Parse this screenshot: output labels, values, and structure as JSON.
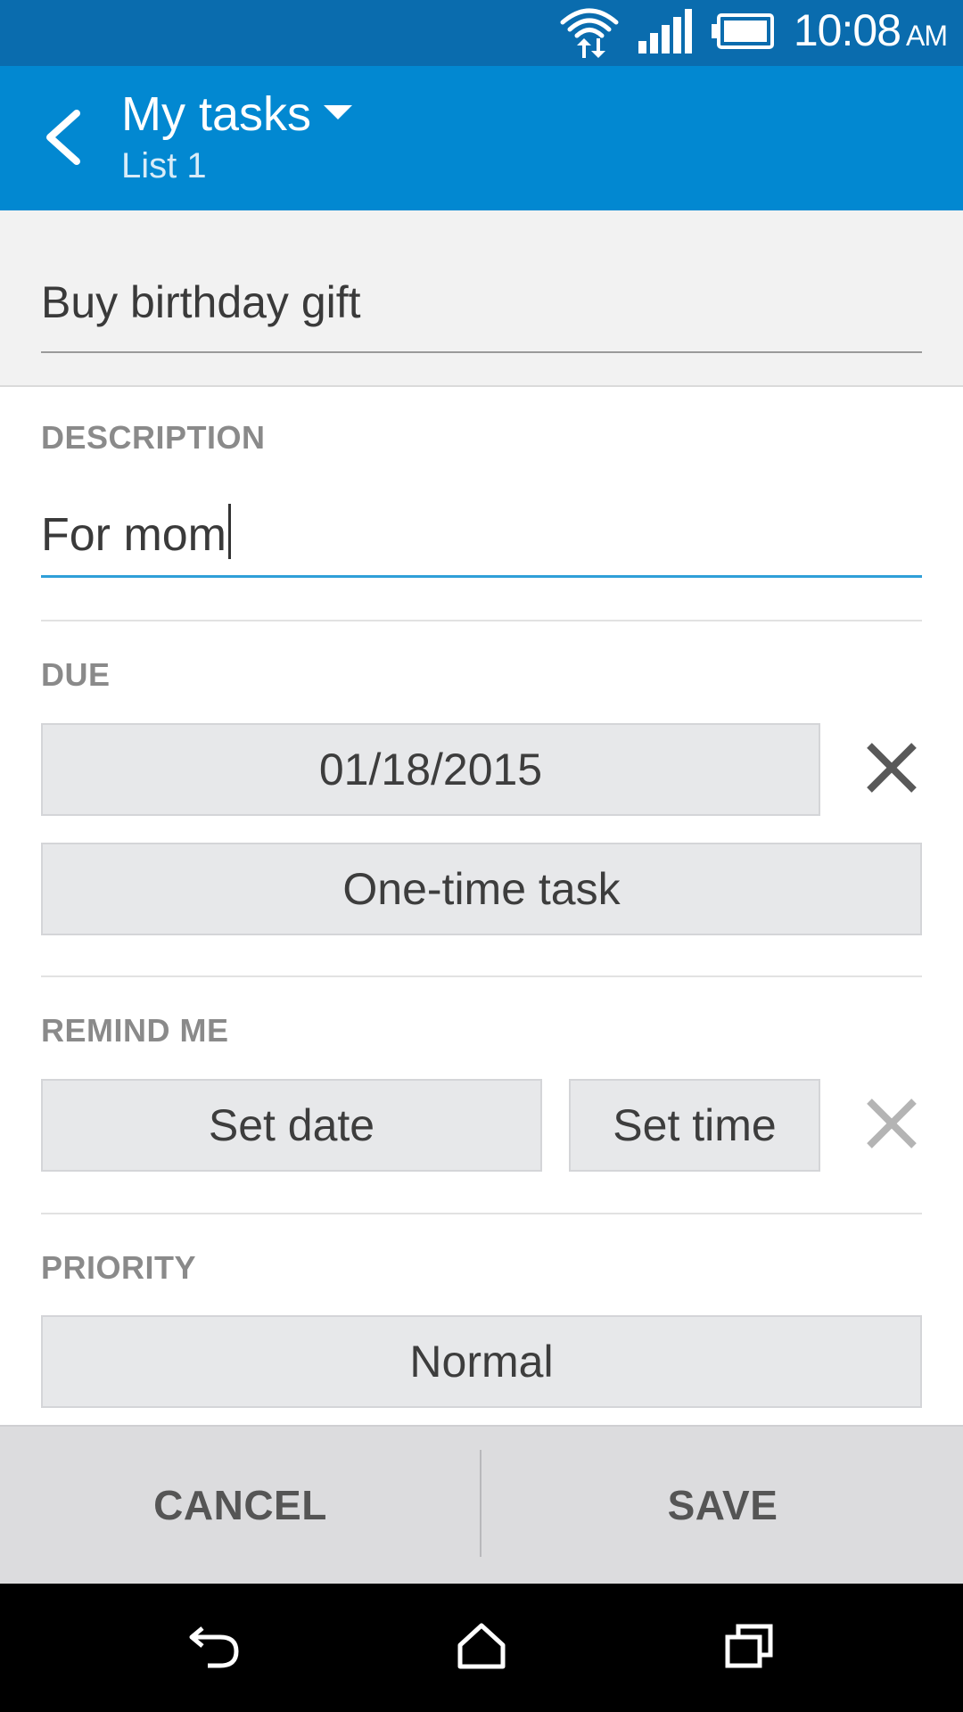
{
  "status_bar": {
    "time": "10:08",
    "ampm": "AM",
    "icons": [
      "wifi-icon",
      "signal-icon",
      "battery-icon"
    ]
  },
  "app_bar": {
    "title": "My tasks",
    "subtitle": "List 1",
    "back_icon": "chevron-left-icon",
    "dropdown_icon": "triangle-down-icon"
  },
  "task": {
    "title": "Buy birthday gift"
  },
  "description": {
    "label": "DESCRIPTION",
    "value": "For mom"
  },
  "due": {
    "label": "DUE",
    "date": "01/18/2015",
    "repeat": "One-time task",
    "clear_icon": "close-icon"
  },
  "remind": {
    "label": "REMIND ME",
    "set_date": "Set date",
    "set_time": "Set time",
    "clear_icon": "close-icon"
  },
  "priority": {
    "label": "PRIORITY",
    "value": "Normal"
  },
  "actions": {
    "cancel": "CANCEL",
    "save": "SAVE"
  },
  "nav": {
    "icons": [
      "back-icon",
      "home-icon",
      "recents-icon"
    ]
  },
  "colors": {
    "status_bar": "#0a6cae",
    "app_bar": "#0288d1",
    "accent": "#2f9fd8"
  }
}
